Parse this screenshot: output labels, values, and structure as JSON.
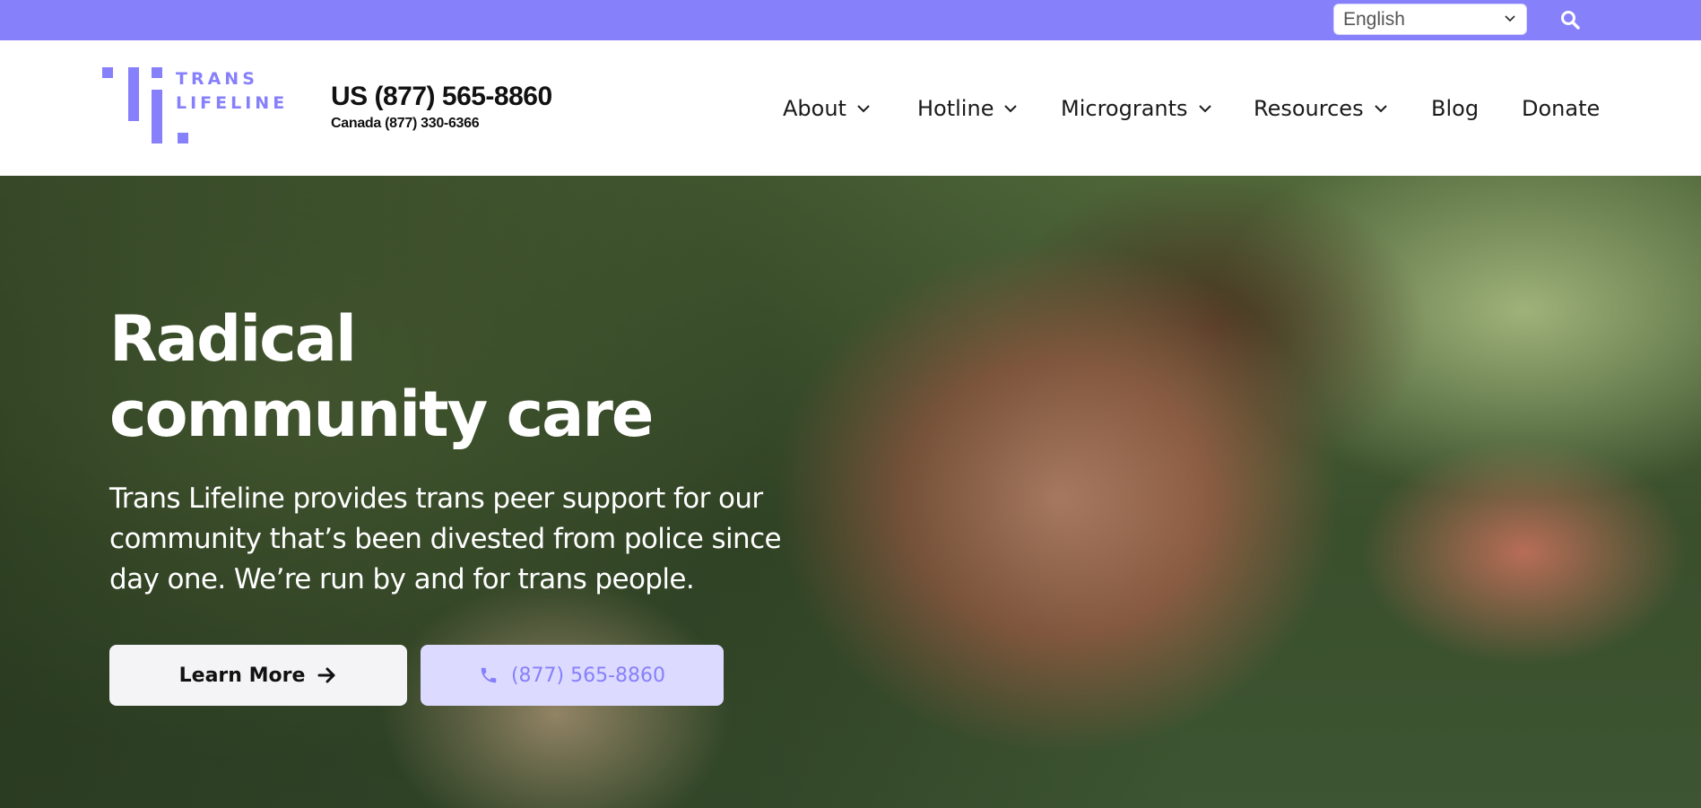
{
  "topbar": {
    "language_select": {
      "selected": "English"
    },
    "search_icon": "search-icon"
  },
  "header": {
    "logo": {
      "line1": "TRANS",
      "line2": "LIFELINE",
      "color": "#8780fb"
    },
    "phone_us": "US (877) 565-8860",
    "phone_canada": "Canada (877) 330-6366",
    "nav": [
      {
        "label": "About",
        "dropdown": true
      },
      {
        "label": "Hotline",
        "dropdown": true
      },
      {
        "label": "Microgrants",
        "dropdown": true
      },
      {
        "label": "Resources",
        "dropdown": true
      },
      {
        "label": "Blog",
        "dropdown": false
      },
      {
        "label": "Donate",
        "dropdown": false
      }
    ]
  },
  "hero": {
    "title_line1": "Radical",
    "title_line2": "community care",
    "text": "Trans Lifeline provides trans peer support for our community that’s been divested from police since day one. We’re run by and for trans people.",
    "learn_more_label": "Learn More",
    "call_label": "(877) 565-8860"
  },
  "colors": {
    "accent": "#8780fb",
    "accent_light": "#dcdaff"
  }
}
